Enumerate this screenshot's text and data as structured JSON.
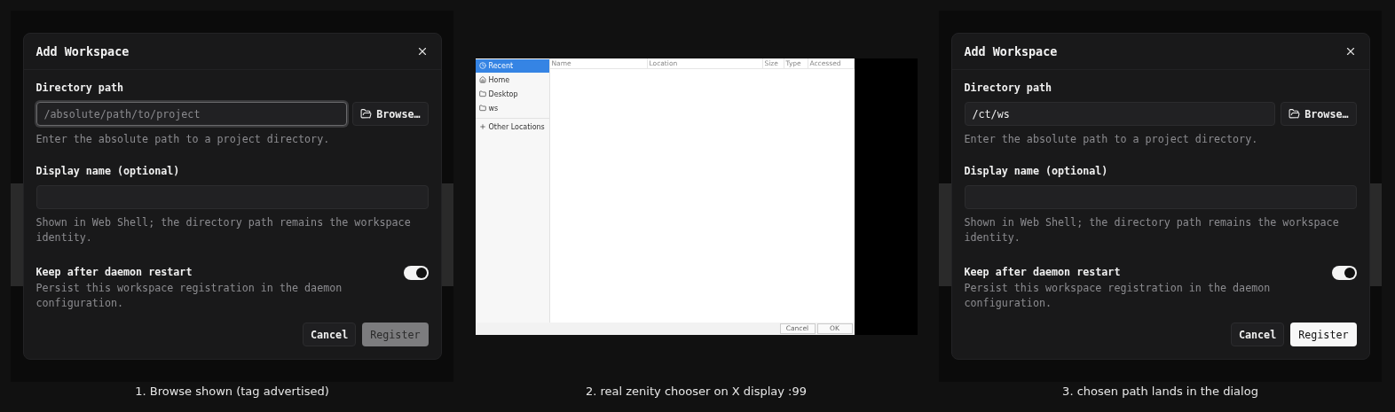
{
  "panels": [
    {
      "kind": "dialog",
      "caption": "1. Browse shown (tag advertised)",
      "dialog": {
        "title": "Add Workspace",
        "directory": {
          "label": "Directory path",
          "placeholder": "/absolute/path/to/project",
          "focused": true,
          "browse": "Browse…",
          "help": "Enter the absolute path to a project directory."
        },
        "display_name": {
          "label": "Display name (optional)",
          "help": "Shown in Web Shell; the directory path remains the workspace identity."
        },
        "keep": {
          "label": "Keep after daemon restart",
          "description": "Persist this workspace registration in the daemon configuration.",
          "on": true
        },
        "buttons": [
          {
            "label": "Cancel",
            "kind": "secondary",
            "disabled": false
          },
          {
            "label": "Register",
            "kind": "primary",
            "disabled": true
          }
        ]
      }
    },
    {
      "kind": "chooser",
      "caption": "2. real zenity chooser on X display :99",
      "chooser": {
        "places": [
          {
            "label": "Recent",
            "selected": true
          },
          {
            "label": "Home",
            "selected": false
          },
          {
            "label": "Desktop",
            "selected": false
          },
          {
            "label": "ws",
            "selected": false
          }
        ],
        "other": "Other Locations",
        "columns": [
          "Name",
          "Location",
          "Size",
          "Type",
          "Accessed"
        ],
        "buttons": [
          "Cancel",
          "OK"
        ]
      }
    },
    {
      "kind": "dialog",
      "caption": "3. chosen path lands in the dialog",
      "dialog": {
        "title": "Add Workspace",
        "directory": {
          "label": "Directory path",
          "value": "/ct/ws",
          "focused": false,
          "browse": "Browse…",
          "help": "Enter the absolute path to a project directory."
        },
        "display_name": {
          "label": "Display name (optional)",
          "help": "Shown in Web Shell; the directory path remains the workspace identity."
        },
        "keep": {
          "label": "Keep after daemon restart",
          "description": "Persist this workspace registration in the daemon configuration.",
          "on": true
        },
        "buttons": [
          {
            "label": "Cancel",
            "kind": "secondary",
            "disabled": false
          },
          {
            "label": "Register",
            "kind": "primary",
            "disabled": false
          }
        ]
      }
    }
  ]
}
